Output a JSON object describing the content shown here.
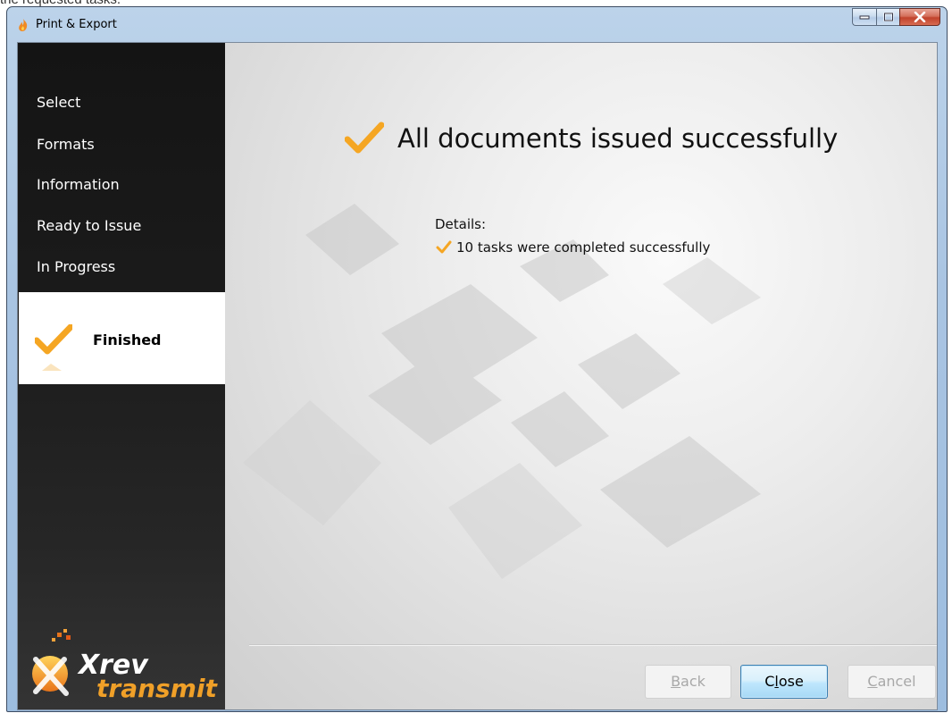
{
  "background_caption": "the requested tasks.",
  "window": {
    "title": "Print & Export"
  },
  "sidebar": {
    "steps": [
      {
        "label": "Select"
      },
      {
        "label": "Formats"
      },
      {
        "label": "Information"
      },
      {
        "label": "Ready to Issue"
      },
      {
        "label": "In Progress"
      }
    ],
    "active_step": {
      "label": "Finished"
    },
    "logo": {
      "line1": "Xrev",
      "line2": "transmit"
    }
  },
  "main": {
    "headline": "All documents issued successfully",
    "details_label": "Details:",
    "tasks": [
      {
        "text": "10 tasks were completed successfully"
      }
    ]
  },
  "buttons": {
    "back": {
      "label": "Back",
      "mnemonic": "B",
      "rest": "ack"
    },
    "close": {
      "label": "Close",
      "pre": "C",
      "mnemonic": "l",
      "rest": "ose"
    },
    "cancel": {
      "label": "Cancel",
      "mnemonic": "C",
      "rest": "ancel"
    }
  },
  "colors": {
    "check_orange": "#f5a623",
    "sidebar_dark": "#1b1b1b",
    "primary_button_border": "#3c7fb1"
  },
  "icons": {
    "app": "flame-icon",
    "check": "checkmark-icon"
  }
}
